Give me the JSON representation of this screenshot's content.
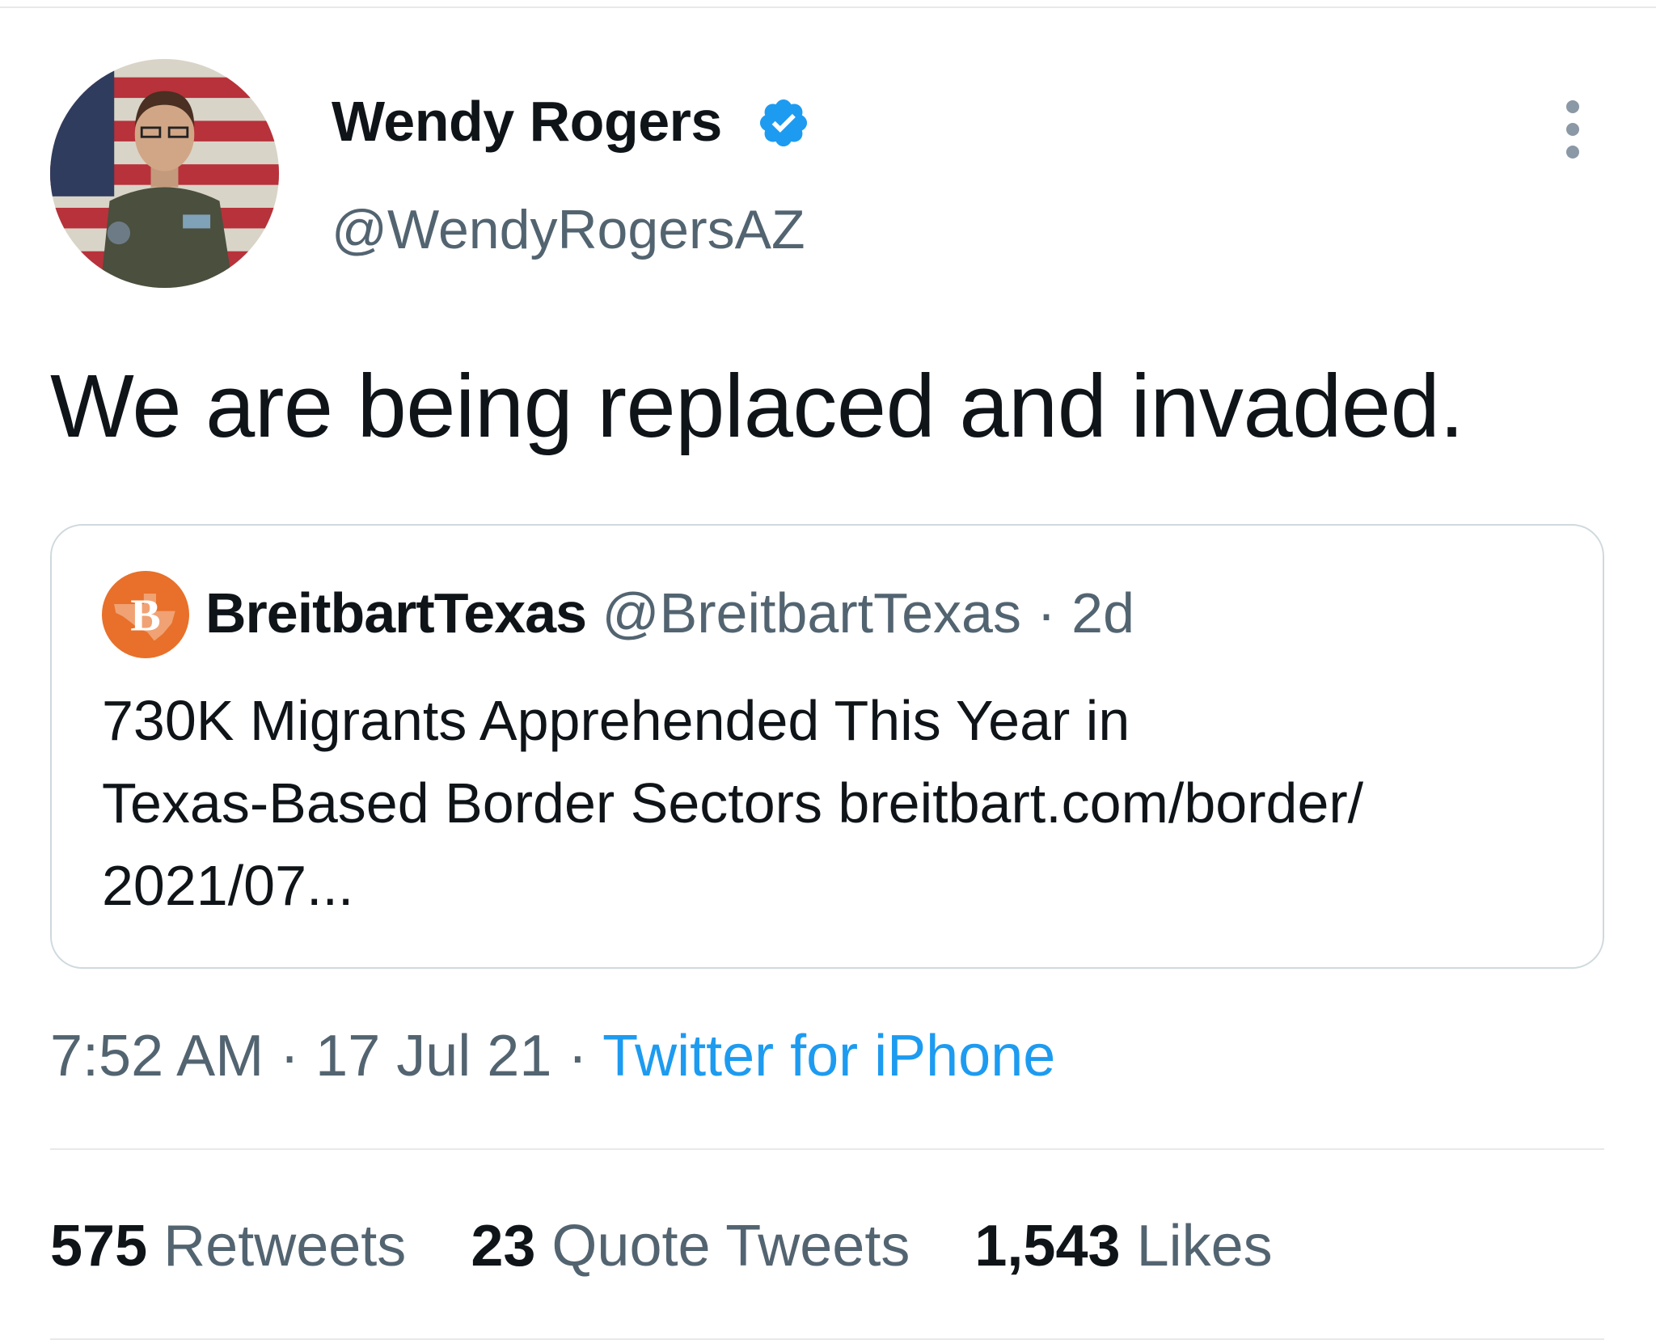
{
  "tweet": {
    "author": {
      "name": "Wendy Rogers",
      "handle": "@WendyRogersAZ",
      "verified_icon": "verified-badge-icon",
      "avatar": "profile-photo"
    },
    "more_icon": "more-vertical-icon",
    "text": "We are being replaced and invaded.",
    "quote": {
      "avatar_icon": "breitbart-logo",
      "name": "BreitbartTexas",
      "handle": "@BreitbartTexas",
      "separator": " · ",
      "time": "2d",
      "lines": [
        "730K Migrants Apprehended This Year in",
        "Texas-Based Border Sectors breitbart.com/border/",
        "2021/07..."
      ]
    },
    "meta": {
      "time": "7:52 AM",
      "separator": " · ",
      "date": "17 Jul 21",
      "source": "Twitter for iPhone"
    },
    "stats": {
      "retweets": {
        "count": "575",
        "label": "Retweets"
      },
      "quote_tweets": {
        "count": "23",
        "label": "Quote Tweets"
      },
      "likes": {
        "count": "1,543",
        "label": "Likes"
      }
    }
  },
  "colors": {
    "text": "#0f1419",
    "secondary": "#536471",
    "link": "#1d9bf0",
    "border": "#cfd9de",
    "breitbart_orange": "#e8702a"
  }
}
